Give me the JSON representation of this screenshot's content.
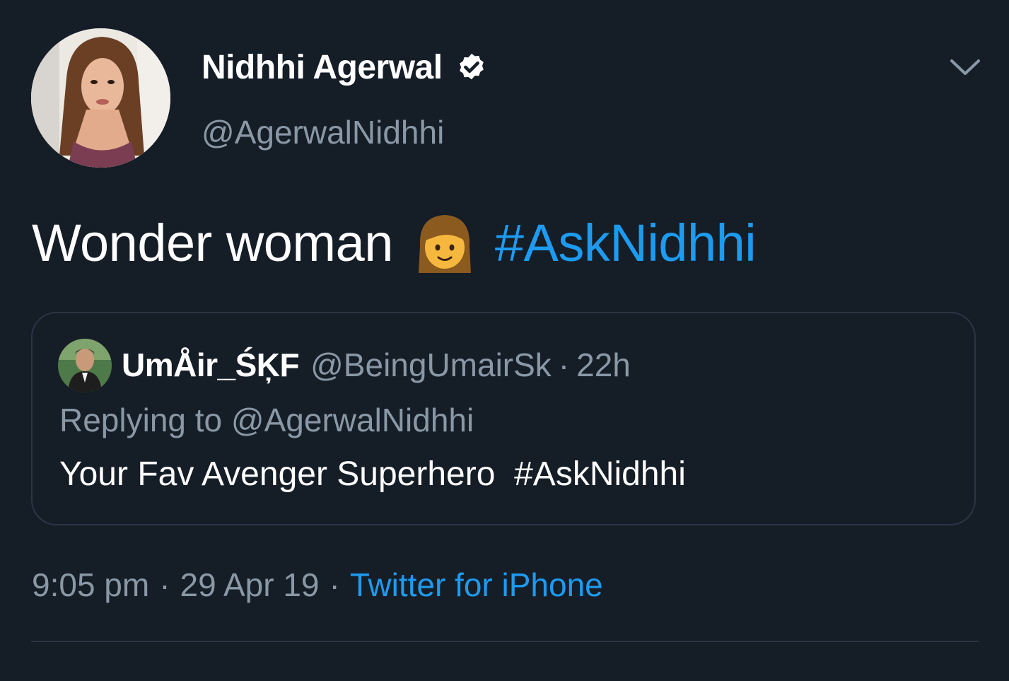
{
  "author": {
    "display_name": "Nidhhi Agerwal",
    "handle": "@AgerwalNidhhi",
    "verified": true,
    "avatar_icon": "profile-photo"
  },
  "tweet": {
    "text": "Wonder woman",
    "emoji": "woman-emoji",
    "hashtag": "#AskNidhhi"
  },
  "quoted_tweet": {
    "display_name": "UmÅir_ŚĶF",
    "handle": "@BeingUmairSk",
    "separator": "·",
    "time": "22h",
    "replying_to": "Replying to @AgerwalNidhhi",
    "text": "Your Fav Avenger Superhero  #AskNidhhi"
  },
  "meta": {
    "time": "9:05 pm",
    "separator": "·",
    "date": "29 Apr 19",
    "source": "Twitter for iPhone"
  },
  "colors": {
    "background": "#151d27",
    "accent": "#1d9bf0",
    "secondary_text": "#8a98a6",
    "border": "#2a3644"
  }
}
